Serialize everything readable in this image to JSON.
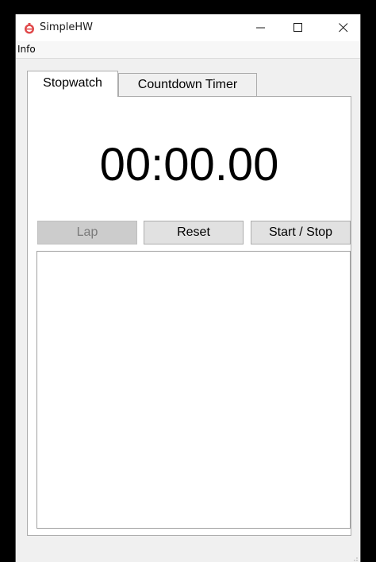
{
  "window": {
    "title": "SimpleHW",
    "controls": {
      "minimize": "minimize",
      "maximize": "maximize",
      "close": "close"
    }
  },
  "menu": {
    "items": [
      "Info"
    ]
  },
  "tabs": [
    {
      "label": "Stopwatch",
      "selected": true
    },
    {
      "label": "Countdown Timer",
      "selected": false
    }
  ],
  "stopwatch": {
    "time": "00:00.00",
    "buttons": {
      "lap": "Lap",
      "reset": "Reset",
      "start_stop": "Start / Stop"
    },
    "lap_enabled": false,
    "laps": []
  },
  "colors": {
    "window_bg": "#f0f0f0",
    "panel_bg": "#ffffff",
    "disabled_button": "#cccccc",
    "icon_red": "#e0484a"
  },
  "icons": {
    "app": "timer-app-icon",
    "minimize": "minimize-icon",
    "maximize": "maximize-icon",
    "close": "close-icon"
  }
}
